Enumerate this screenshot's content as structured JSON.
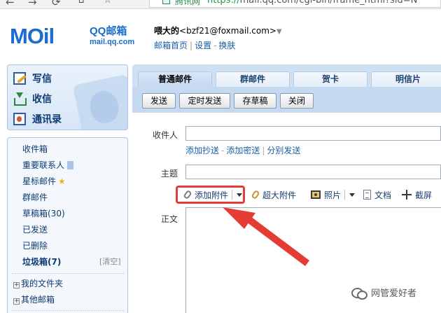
{
  "browser": {
    "secure_label": "腾讯网",
    "url_scheme": "https://",
    "url_rest": "mail.qq.com/cgi-bin/frame_html?sid=N"
  },
  "header": {
    "logo_word": "MOil",
    "brand_title": "QQ邮箱",
    "brand_domain": "mail.qq.com",
    "user_name": "喂大的",
    "user_email": "<bzf21@foxmail.com>",
    "caret": "▼",
    "link_home": "邮箱首页",
    "link_settings": "设置",
    "link_skin": "换肤",
    "sep": "|",
    "sep_dash": "-"
  },
  "sidebar": {
    "write": "写信",
    "receive": "收信",
    "contacts": "通讯录",
    "folders": {
      "inbox": "收件箱",
      "vip": "重要联系人",
      "starred": "星标邮件",
      "group": "群邮件",
      "drafts": "草稿箱(30)",
      "sent": "已发送",
      "deleted": "已删除",
      "spam": "垃圾箱(7)",
      "clear": "[清空]",
      "my_folders": "我的文件夹",
      "other_mailboxes": "其他邮箱"
    },
    "star_glyph": "★",
    "plus_glyph": "+"
  },
  "tabs": {
    "normal": "普通邮件",
    "group": "群邮件",
    "card": "贺卡",
    "postcard": "明信片"
  },
  "toolbar": {
    "send": "发送",
    "scheduled": "定时发送",
    "save_draft": "存草稿",
    "close": "关闭"
  },
  "compose": {
    "to_label": "收件人",
    "add_cc": "添加抄送",
    "add_bcc": "添加密送",
    "separate": "分别发送",
    "subject_label": "主题",
    "body_label": "正文",
    "attach": "添加附件",
    "big_attach": "超大附件",
    "photo": "照片",
    "document": "文档",
    "screenshot": "截屏"
  },
  "colors": {
    "annotation_red": "#e53d36",
    "brand_blue": "#1a6dcc"
  },
  "watermark": {
    "text": "网管爱好者"
  }
}
